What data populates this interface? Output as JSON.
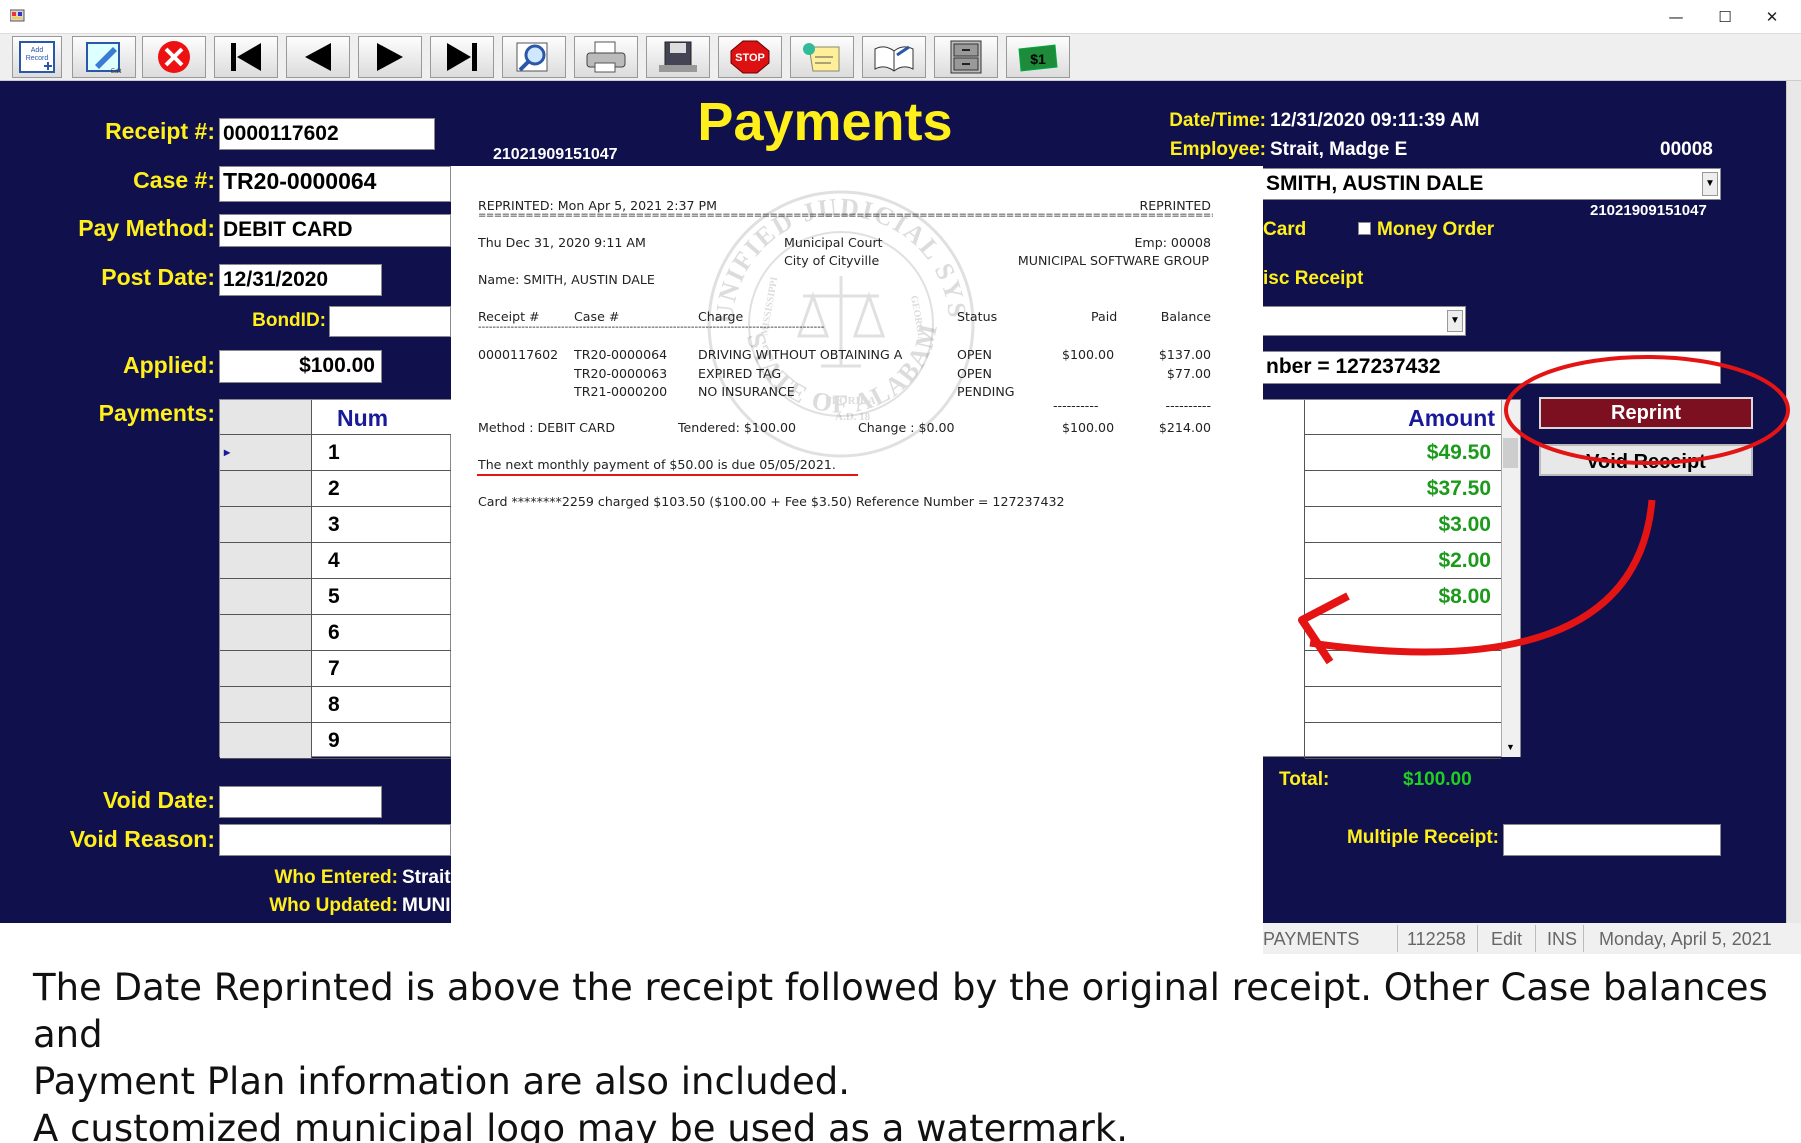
{
  "window": {
    "minimize": "—",
    "maximize": "☐",
    "close": "✕"
  },
  "toolbar": {
    "buttons": [
      {
        "name": "add-record",
        "label": "Add Record"
      },
      {
        "name": "edit",
        "label": "Edit"
      },
      {
        "name": "delete"
      },
      {
        "name": "first-record"
      },
      {
        "name": "previous-record"
      },
      {
        "name": "next-record"
      },
      {
        "name": "last-record"
      },
      {
        "name": "search"
      },
      {
        "name": "print"
      },
      {
        "name": "save"
      },
      {
        "name": "stop",
        "label": "STOP"
      },
      {
        "name": "notes"
      },
      {
        "name": "book"
      },
      {
        "name": "cabinet"
      },
      {
        "name": "money",
        "label": "$1"
      }
    ]
  },
  "form": {
    "title": "Payments",
    "receipt_label": "Receipt #:",
    "receipt_value": "0000117602",
    "barcode_left": "21021909151047",
    "case_label": "Case #:",
    "case_value": "TR20-0000064",
    "paymethod_label": "Pay Method:",
    "paymethod_value": "DEBIT CARD",
    "postdate_label": "Post Date:",
    "postdate_value": "12/31/2020",
    "bondid_label": "BondID:",
    "applied_label": "Applied:",
    "applied_value": "$100.00",
    "payments_label": "Payments:",
    "num_header": "Num",
    "rows": [
      "1",
      "2",
      "3",
      "4",
      "5",
      "6",
      "7",
      "8",
      "9"
    ],
    "amount_header": "Amount",
    "amounts": [
      "$49.50",
      "$37.50",
      "$3.00",
      "$2.00",
      "$8.00",
      "",
      "",
      "",
      ""
    ],
    "datetime_label": "Date/Time:",
    "datetime_value": "12/31/2020 09:11:39 AM",
    "employee_label": "Employee:",
    "employee_value": "Strait, Madge E",
    "employee_code": "00008",
    "payor_value": "SMITH, AUSTIN DALE",
    "barcode_right": "21021909151047",
    "card_label": "Card",
    "money_order_label": "Money Order",
    "misc_receipt_label": "isc Receipt",
    "reference_text": "nber = 127237432",
    "reprint_label": "Reprint",
    "void_receipt_label": "Void Receipt",
    "total_label": "Total:",
    "total_value": "$100.00",
    "void_date_label": "Void Date:",
    "void_reason_label": "Void Reason:",
    "multiple_receipt_label": "Multiple Receipt:",
    "who_entered_label": "Who Entered:",
    "who_entered_value": "Strait",
    "who_updated_label": "Who Updated:",
    "who_updated_value": "MUNI"
  },
  "receipt": {
    "reprinted_line": "REPRINTED:  Mon Apr 5, 2021 2:37 PM",
    "reprinted_right": "REPRINTED",
    "dashes": "================================================================================================",
    "orig_date": "Thu Dec 31, 2020 9:11 AM",
    "court": "Municipal Court",
    "city": "City of Cityville",
    "emp": "Emp:  00008",
    "group": "MUNICIPAL SOFTWARE GROUP",
    "name_line": "Name: SMITH, AUSTIN DALE",
    "headers": {
      "receipt": "Receipt #",
      "case": "Case #",
      "charge": "Charge",
      "status": "Status",
      "paid": "Paid",
      "balance": "Balance"
    },
    "dash_line": "------------------------------------------------------------------------------------------------",
    "receipt_no": "0000117602",
    "lines": [
      {
        "case": "TR20-0000064",
        "charge": "DRIVING WITHOUT OBTAINING A",
        "status": "OPEN",
        "paid": "$100.00",
        "balance": "$137.00"
      },
      {
        "case": "TR20-0000063",
        "charge": "EXPIRED TAG",
        "status": "OPEN",
        "paid": "",
        "balance": "$77.00"
      },
      {
        "case": "TR21-0000200",
        "charge": "NO INSURANCE",
        "status": "PENDING",
        "paid": "",
        "balance": ""
      }
    ],
    "sum_dashes": "----------",
    "method": "Method :  DEBIT CARD",
    "tendered": "Tendered: $100.00",
    "change": "Change :  $0.00",
    "total_paid": "$100.00",
    "total_balance": "$214.00",
    "plan_note": "The next monthly payment of $50.00 is due 05/05/2021.",
    "card_note": "Card ********2259 charged $103.50 ($100.00 +  Fee $3.50)  Reference Number = 127237432",
    "seal_top": "UNIFIED JUDICIAL SYSTEM",
    "seal_bottom": "STATE OF ALABAMA",
    "seal_left": "MISSISSIPPI",
    "seal_right": "GEORGIA",
    "seal_florida": "FLORIDA",
    "seal_ad": "A.D. 18"
  },
  "statusbar": {
    "module": "PAYMENTS",
    "record": "112258",
    "mode": "Edit",
    "ins": "INS",
    "date": "Monday, April 5, 2021"
  },
  "caption": {
    "line1": "The Date Reprinted is above the receipt followed by the original receipt. Other Case balances and",
    "line2": "Payment Plan information are also included.",
    "line3": "A customized municipal logo may be used as a watermark."
  },
  "colors": {
    "navy": "#10104d",
    "label_yellow": "#ffef1a",
    "amount_green": "#1b9a1b",
    "annotation_red": "#e41414",
    "reprint_maroon": "#7d1020"
  }
}
